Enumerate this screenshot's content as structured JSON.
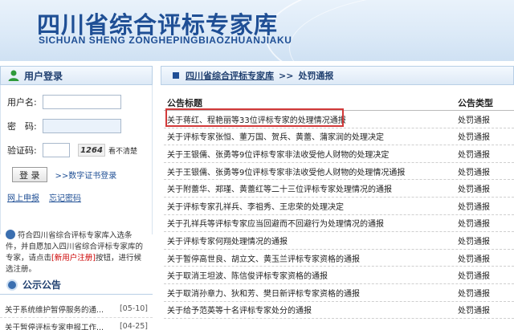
{
  "header": {
    "title": "四川省综合评标专家库",
    "subtitle": "SICHUAN SHENG ZONGHEPINGBIAOZHUANJIAKU"
  },
  "login": {
    "panel_title": "用户登录",
    "username_label": "用户名:",
    "password_label": "密　码:",
    "captcha_label": "验证码:",
    "captcha_text": "1264",
    "captcha_unclear": "看不清楚",
    "login_button": "登 录",
    "cert_login": ">>数字证书登录",
    "online_apply": "网上申报",
    "forgot_password": "忘记密码"
  },
  "notice": {
    "text_before": "符合四川省综合评标专家库入选条件，并自愿加入四川省综合评标专家库的专家，请点击",
    "register": "[新用户注册]",
    "text_after": "按钮，进行候选注册。"
  },
  "announcements": {
    "title": "公示公告",
    "items": [
      {
        "title": "关于系统维护暂停服务的通...",
        "date": "[05-10]"
      },
      {
        "title": "关于暂停评标专家申报工作...",
        "date": "[04-25]"
      }
    ]
  },
  "breadcrumb": {
    "home": "四川省综合评标专家库",
    "separator": ">>",
    "current": "处罚通报"
  },
  "table": {
    "col_title": "公告标题",
    "col_type": "公告类型",
    "rows": [
      {
        "title": "关于蒋红、程艳丽等33位评标专家的处理情况通报",
        "type": "处罚通报"
      },
      {
        "title": "关于评标专家张恒、董万国、贺兵、黄蕾、蒲家润的处理决定",
        "type": "处罚通报"
      },
      {
        "title": "关于王银儒、张勇等9位评标专家非法收受他人财物的处理决定",
        "type": "处罚通报"
      },
      {
        "title": "关于王银儒、张勇等9位评标专家非法收受他人财物的处理情况通报",
        "type": "处罚通报"
      },
      {
        "title": "关于附蕾华、郑瑾、黄蕾红等二十三位评标专家处理情况的通报",
        "type": "处罚通报"
      },
      {
        "title": "关于评标专家孔祥兵、李祖秀、王忠荣的处理决定",
        "type": "处罚通报"
      },
      {
        "title": "关于孔祥兵等评标专家应当回避而不回避行为处理情况的通报",
        "type": "处罚通报"
      },
      {
        "title": "关于评标专家何翔处理情况的通报",
        "type": "处罚通报"
      },
      {
        "title": "关于暂停高世良、胡立文、黄玉兰评标专家资格的通报",
        "type": "处罚通报"
      },
      {
        "title": "关于取消王坦波、陈信俊评标专家资格的通报",
        "type": "处罚通报"
      },
      {
        "title": "关于取消孙章力、狄和芳、樊日新评标专家资格的通报",
        "type": "处罚通报"
      },
      {
        "title": "关于给予范英等十名评标专家处分的通报",
        "type": "处罚通报"
      }
    ]
  },
  "colors": {
    "brand_blue": "#1f4f95",
    "highlight_red": "#d23a3a"
  }
}
